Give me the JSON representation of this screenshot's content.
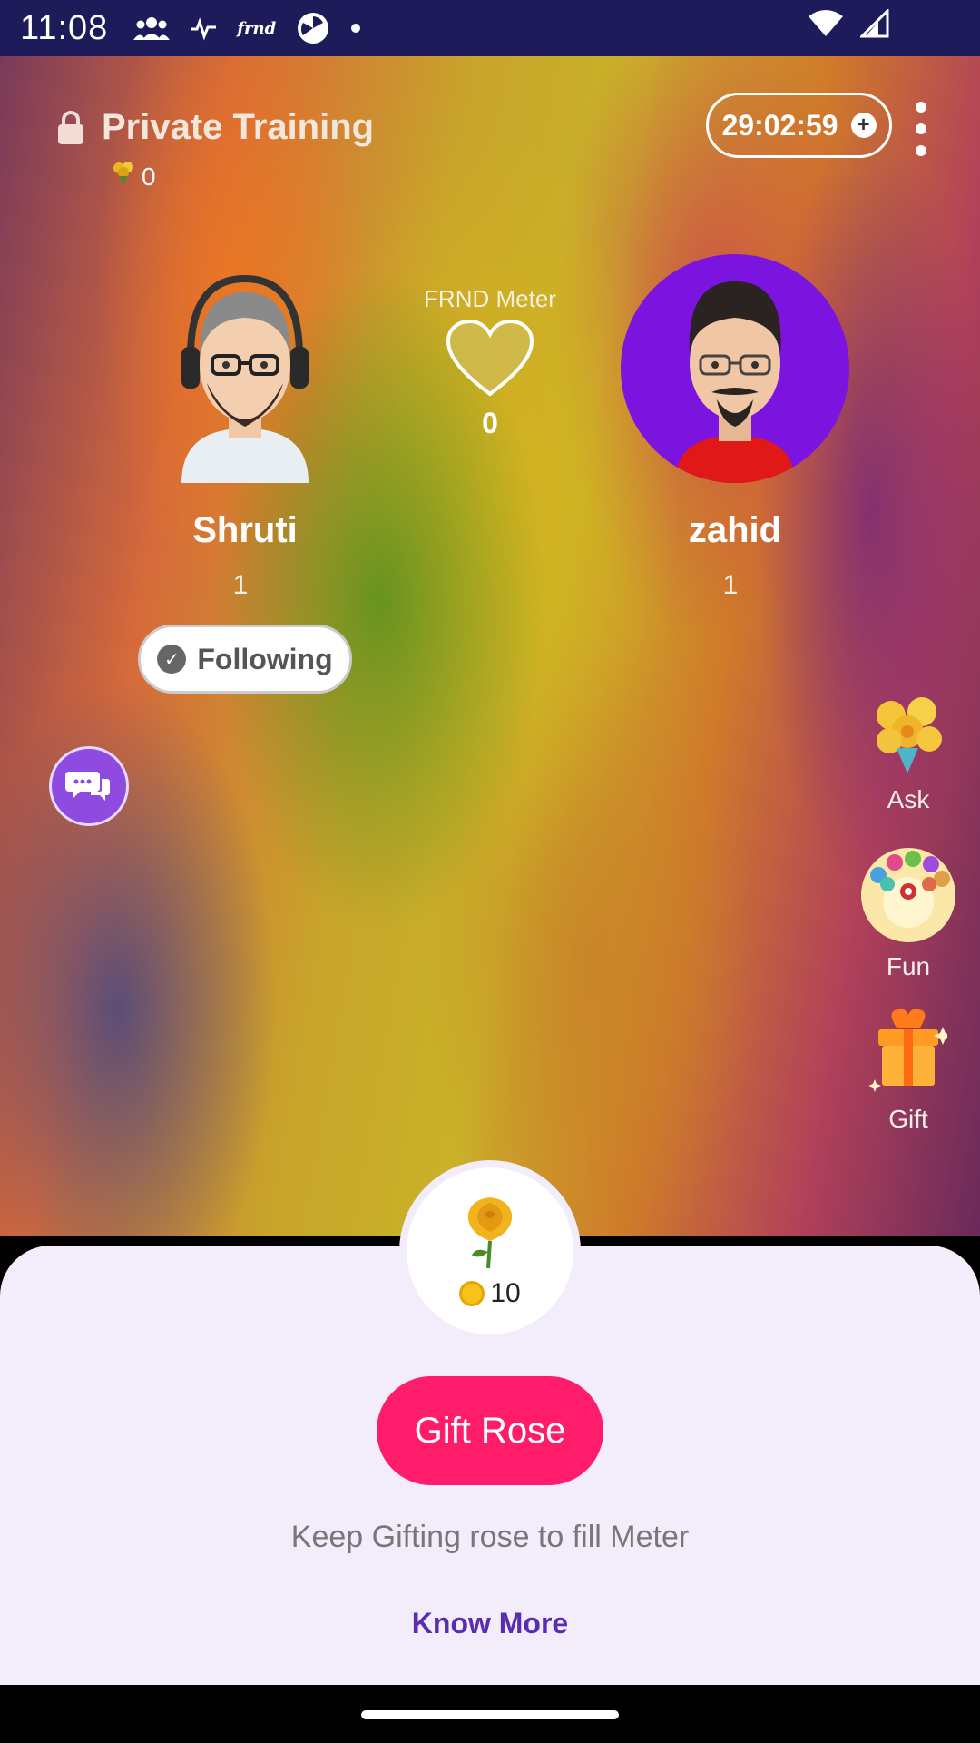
{
  "status_bar": {
    "time": "11:08",
    "app_mini_label": "frnd"
  },
  "header": {
    "title": "Private Training",
    "rose_count": "0",
    "timer": "29:02:59"
  },
  "meter": {
    "label": "FRND Meter",
    "value": "0"
  },
  "users": [
    {
      "name": "Shruti",
      "level": "1"
    },
    {
      "name": "zahid",
      "level": "1"
    }
  ],
  "following_label": "Following",
  "side_actions": {
    "ask": "Ask",
    "fun": "Fun",
    "gift": "Gift"
  },
  "rose_offer": {
    "price": "10",
    "button_label": "Gift Rose",
    "hint": "Keep Gifting rose to fill Meter",
    "link": "Know More"
  },
  "colors": {
    "status_bar": "#1d1b5a",
    "accent_pink": "#ff1d6b",
    "avatar_bg": "#7c14e0",
    "link_purple": "#5a2db0",
    "sheet_bg": "#f2ecfb"
  }
}
